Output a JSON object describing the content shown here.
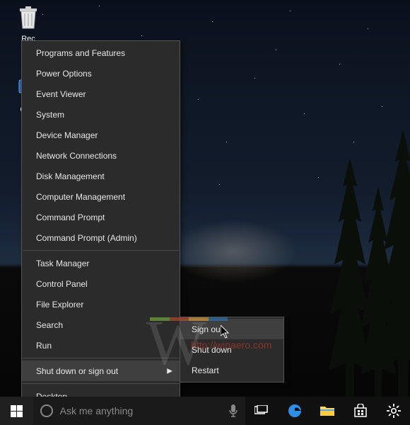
{
  "desktop": {
    "icons": [
      {
        "name": "recycle-bin",
        "label": "Recycle Bin",
        "shortlabel": "Rec"
      },
      {
        "name": "computer",
        "label": "Computer",
        "shortlabel": "Com"
      }
    ]
  },
  "taskbar": {
    "search_placeholder": "Ask me anything"
  },
  "context_menu": {
    "groups": [
      [
        "Programs and Features",
        "Power Options",
        "Event Viewer",
        "System",
        "Device Manager",
        "Network Connections",
        "Disk Management",
        "Computer Management",
        "Command Prompt",
        "Command Prompt (Admin)"
      ],
      [
        "Task Manager",
        "Control Panel",
        "File Explorer",
        "Search",
        "Run"
      ],
      [
        "Shut down or sign out"
      ],
      [
        "Desktop"
      ]
    ],
    "highlighted": "Shut down or sign out",
    "submenu_parent": "Shut down or sign out"
  },
  "submenu": {
    "items": [
      "Sign out",
      "Shut down",
      "Restart"
    ],
    "highlighted": "Sign out"
  },
  "watermark": {
    "url": "http://winaero.com",
    "colors": [
      "#7fbc3f",
      "#c94b2c",
      "#f2a93c",
      "#2c7abf"
    ]
  }
}
